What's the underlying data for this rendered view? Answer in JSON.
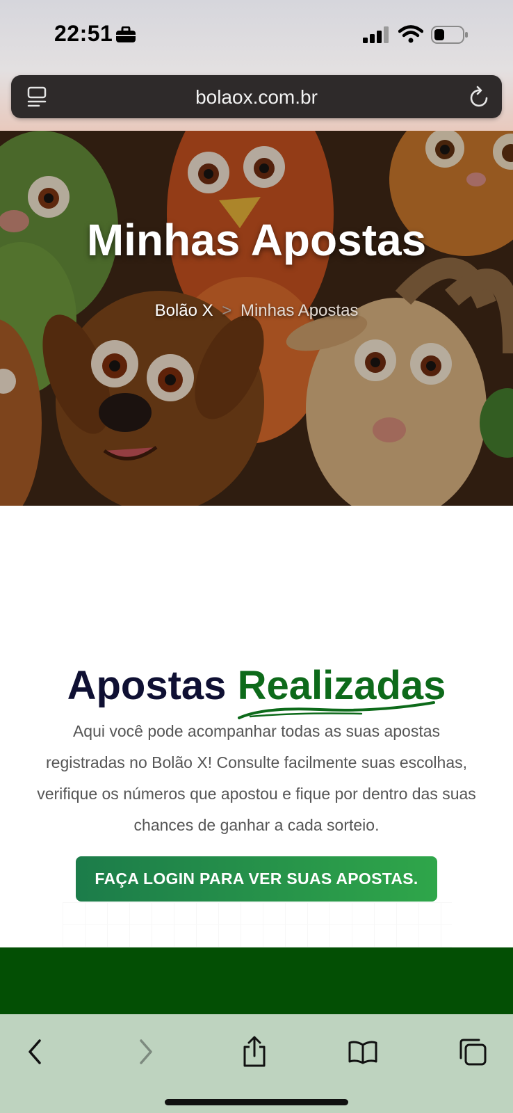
{
  "status_bar": {
    "time": "22:51",
    "icons": [
      "briefcase-icon",
      "cellular-signal-icon",
      "wifi-icon",
      "battery-icon"
    ]
  },
  "browser": {
    "url": "bolaox.com.br",
    "left_icon": "reader-mode-icon",
    "right_icon": "reload-icon"
  },
  "hero": {
    "title": "Minhas Apostas",
    "breadcrumb": {
      "home": "Bolão X",
      "separator": ">",
      "current": "Minhas Apostas"
    }
  },
  "section": {
    "title_main": "Apostas",
    "title_accent": "Realizadas",
    "description": "Aqui você pode acompanhar todas as suas apostas registradas no Bolão X! Consulte facilmente suas escolhas, verifique os números que apostou e fique por dentro das suas chances de ganhar a cada sorteio.",
    "login_button": "FAÇA LOGIN PARA VER SUAS APOSTAS."
  },
  "toolbar": {
    "items": [
      "back-icon",
      "forward-icon",
      "share-icon",
      "bookmarks-icon",
      "tabs-icon"
    ]
  },
  "colors": {
    "accent_green": "#0d6a1a",
    "button_green": "#2fa64a",
    "footer_green": "#034f04",
    "toolbar_bg": "#bed3bf",
    "title_navy": "#0f1033"
  }
}
